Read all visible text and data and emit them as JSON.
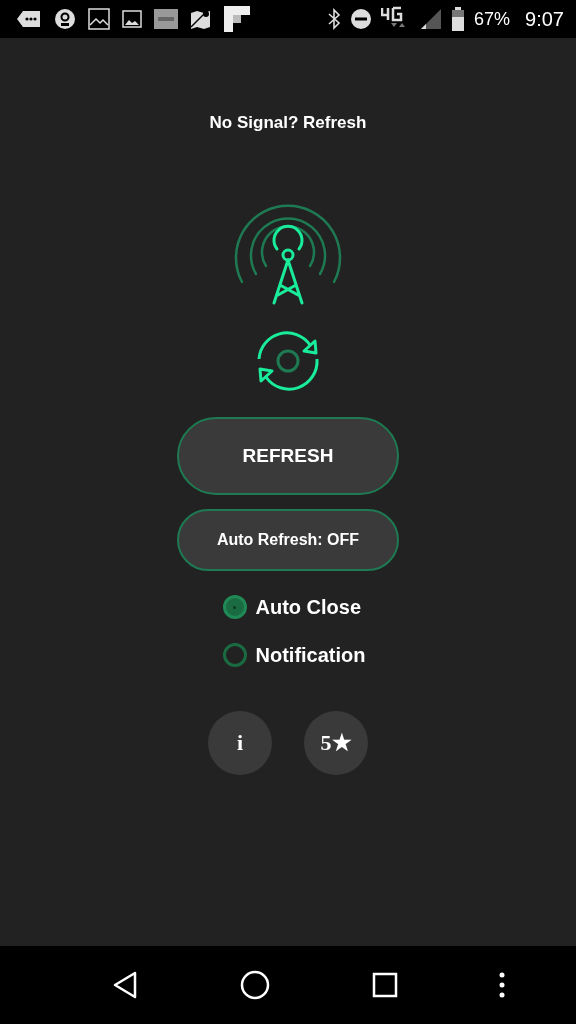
{
  "status_bar": {
    "battery": "67%",
    "time": "9:07"
  },
  "title": "No Signal? Refresh",
  "refresh_button": "REFRESH",
  "auto_refresh_button": "Auto Refresh: OFF",
  "options": [
    {
      "label": "Auto Close",
      "selected": true
    },
    {
      "label": "Notification",
      "selected": false
    }
  ],
  "round_buttons": [
    "i",
    "5★"
  ]
}
